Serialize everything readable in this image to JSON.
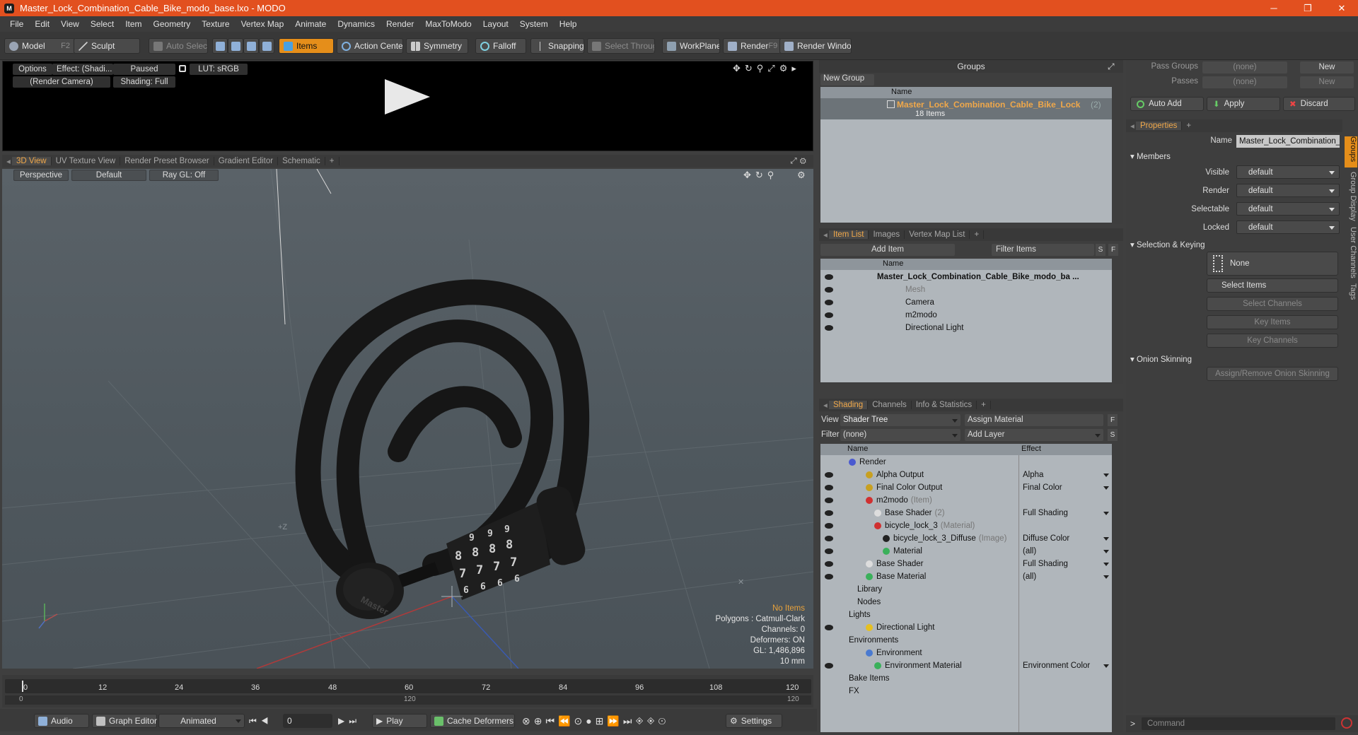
{
  "window": {
    "title": "Master_Lock_Combination_Cable_Bike_modo_base.lxo - MODO",
    "icon_label": "M"
  },
  "menu": [
    "File",
    "Edit",
    "View",
    "Select",
    "Item",
    "Geometry",
    "Texture",
    "Vertex Map",
    "Animate",
    "Dynamics",
    "Render",
    "MaxToModo",
    "Layout",
    "System",
    "Help"
  ],
  "toolbar": {
    "model": "Model",
    "model_key": "F2",
    "sculpt": "Sculpt",
    "auto_select": "Auto Select",
    "items": "Items",
    "action_center": "Action Center",
    "symmetry": "Symmetry",
    "falloff": "Falloff",
    "snapping": "Snapping",
    "select_through": "Select Through",
    "workplane": "WorkPlane",
    "render": "Render",
    "render_key": "F9",
    "render_window": "Render Window"
  },
  "preview": {
    "options": "Options",
    "effect": "Effect: (Shadi...",
    "paused": "Paused",
    "lut": "LUT: sRGB",
    "camera": "(Render Camera)",
    "shading": "Shading: Full"
  },
  "viewport_tabs": [
    "3D View",
    "UV Texture View",
    "Render Preset Browser",
    "Gradient Editor",
    "Schematic",
    "+"
  ],
  "viewport": {
    "perspective": "Perspective",
    "default": "Default",
    "raygl": "Ray GL: Off",
    "coord_label": "+Z",
    "dial_numbers": [
      "8",
      "8",
      "8",
      "8",
      "7",
      "7",
      "7",
      "7",
      "6",
      "6",
      "6",
      "6",
      "9",
      "9",
      "9"
    ],
    "brand": "Master",
    "info": {
      "no_items": "No Items",
      "polygons": "Polygons : Catmull-Clark",
      "channels": "Channels: 0",
      "deformers": "Deformers: ON",
      "gl": "GL: 1,486,896",
      "scale": "10 mm"
    }
  },
  "timeline": {
    "ticks": [
      "0",
      "12",
      "24",
      "36",
      "48",
      "60",
      "72",
      "84",
      "96",
      "108",
      "120"
    ],
    "bottom_left": "0",
    "bottom_mid": "120",
    "bottom_right": "120"
  },
  "bottombar": {
    "audio": "Audio",
    "graph_editor": "Graph Editor",
    "animated": "Animated",
    "frame": "0",
    "play": "Play",
    "cache": "Cache Deformers",
    "settings": "Settings"
  },
  "groups": {
    "title": "Groups",
    "new_group": "New Group",
    "col_name": "Name",
    "item_name": "Master_Lock_Combination_Cable_Bike_Lock",
    "item_count": "(2)",
    "item_sub": "18 Items"
  },
  "pass": {
    "pass_groups": "Pass Groups",
    "passes": "Passes",
    "none": "(none)",
    "new": "New"
  },
  "actions": {
    "auto_add": "Auto Add",
    "apply": "Apply",
    "discard": "Discard"
  },
  "itemlist": {
    "tabs": [
      "Item List",
      "Images",
      "Vertex Map List",
      "+"
    ],
    "add_item": "Add Item",
    "filter": "Filter Items",
    "s": "S",
    "f": "F",
    "col_name": "Name",
    "rows": [
      {
        "label": "Master_Lock_Combination_Cable_Bike_modo_ba ...",
        "indent": 0,
        "bold": true,
        "eye": true
      },
      {
        "label": "Mesh",
        "indent": 1,
        "dim": true,
        "eye": true
      },
      {
        "label": "Camera",
        "indent": 1,
        "eye": true
      },
      {
        "label": "m2modo",
        "indent": 1,
        "eye": true
      },
      {
        "label": "Directional Light",
        "indent": 1,
        "eye": true
      }
    ]
  },
  "shading": {
    "tabs": [
      "Shading",
      "Channels",
      "Info & Statistics",
      "+"
    ],
    "view_label": "View",
    "view_value": "Shader Tree",
    "assign": "Assign Material",
    "filter_label": "Filter",
    "filter_value": "(none)",
    "add_layer": "Add Layer",
    "s": "S",
    "f": "F",
    "col_name": "Name",
    "col_effect": "Effect",
    "rows": [
      {
        "label": "Render",
        "indent": 0,
        "orb": "#4a5ad0",
        "effect": "",
        "eye": false
      },
      {
        "label": "Alpha Output",
        "indent": 2,
        "orb": "#c8a020",
        "effect": "Alpha",
        "eye": true
      },
      {
        "label": "Final Color Output",
        "indent": 2,
        "orb": "#c8a020",
        "effect": "Final Color",
        "eye": true
      },
      {
        "label": "m2modo",
        "note": "(Item)",
        "indent": 2,
        "orb": "#d03030",
        "effect": "",
        "eye": true
      },
      {
        "label": "Base Shader",
        "note": "(2)",
        "indent": 3,
        "orb": "#dddddd",
        "effect": "Full Shading",
        "eye": true
      },
      {
        "label": "bicycle_lock_3",
        "note": "(Material)",
        "indent": 3,
        "orb": "#d03030",
        "effect": "",
        "eye": true
      },
      {
        "label": "bicycle_lock_3_Diffuse",
        "note": "(Image)",
        "indent": 4,
        "orb": "#222222",
        "effect": "Diffuse Color",
        "eye": true
      },
      {
        "label": "Material",
        "indent": 4,
        "orb": "#3ab05a",
        "effect": "(all)",
        "eye": true
      },
      {
        "label": "Base Shader",
        "indent": 2,
        "orb": "#dddddd",
        "effect": "Full Shading",
        "eye": true
      },
      {
        "label": "Base Material",
        "indent": 2,
        "orb": "#3ab05a",
        "effect": "(all)",
        "eye": true
      },
      {
        "label": "Library",
        "indent": 1,
        "orb": "",
        "effect": "",
        "eye": false
      },
      {
        "label": "Nodes",
        "indent": 1,
        "orb": "",
        "effect": "",
        "eye": false
      },
      {
        "label": "Lights",
        "indent": 0,
        "orb": "",
        "effect": "",
        "eye": false
      },
      {
        "label": "Directional Light",
        "indent": 2,
        "orb": "#e6c020",
        "effect": "",
        "eye": true
      },
      {
        "label": "Environments",
        "indent": 0,
        "orb": "",
        "effect": "",
        "eye": false
      },
      {
        "label": "Environment",
        "indent": 2,
        "orb": "#4a7ad0",
        "effect": "",
        "eye": false
      },
      {
        "label": "Environment Material",
        "indent": 3,
        "orb": "#3ab05a",
        "effect": "Environment Color",
        "eye": true
      },
      {
        "label": "Bake Items",
        "indent": 0,
        "orb": "",
        "effect": "",
        "eye": false
      },
      {
        "label": "FX",
        "indent": 0,
        "orb": "",
        "effect": "",
        "eye": false
      }
    ]
  },
  "properties": {
    "tab": "Properties",
    "name_label": "Name",
    "name_value": "Master_Lock_Combination_Cable_Bi",
    "members": "Members",
    "fields": [
      {
        "label": "Visible",
        "value": "default"
      },
      {
        "label": "Render",
        "value": "default"
      },
      {
        "label": "Selectable",
        "value": "default"
      },
      {
        "label": "Locked",
        "value": "default"
      }
    ],
    "selection_keying": "Selection & Keying",
    "none": "None",
    "select_items": "Select Items",
    "select_channels": "Select Channels",
    "key_items": "Key Items",
    "key_channels": "Key Channels",
    "onion": "Onion Skinning",
    "assign_onion": "Assign/Remove Onion Skinning"
  },
  "side_tabs": [
    "Groups",
    "Group Display",
    "User Channels",
    "Tags"
  ],
  "command": {
    "placeholder": "Command",
    "prompt": ">"
  },
  "colors": {
    "accent": "#e58e1a",
    "titlebar": "#e2501f",
    "selected_text": "#f0a84a"
  }
}
